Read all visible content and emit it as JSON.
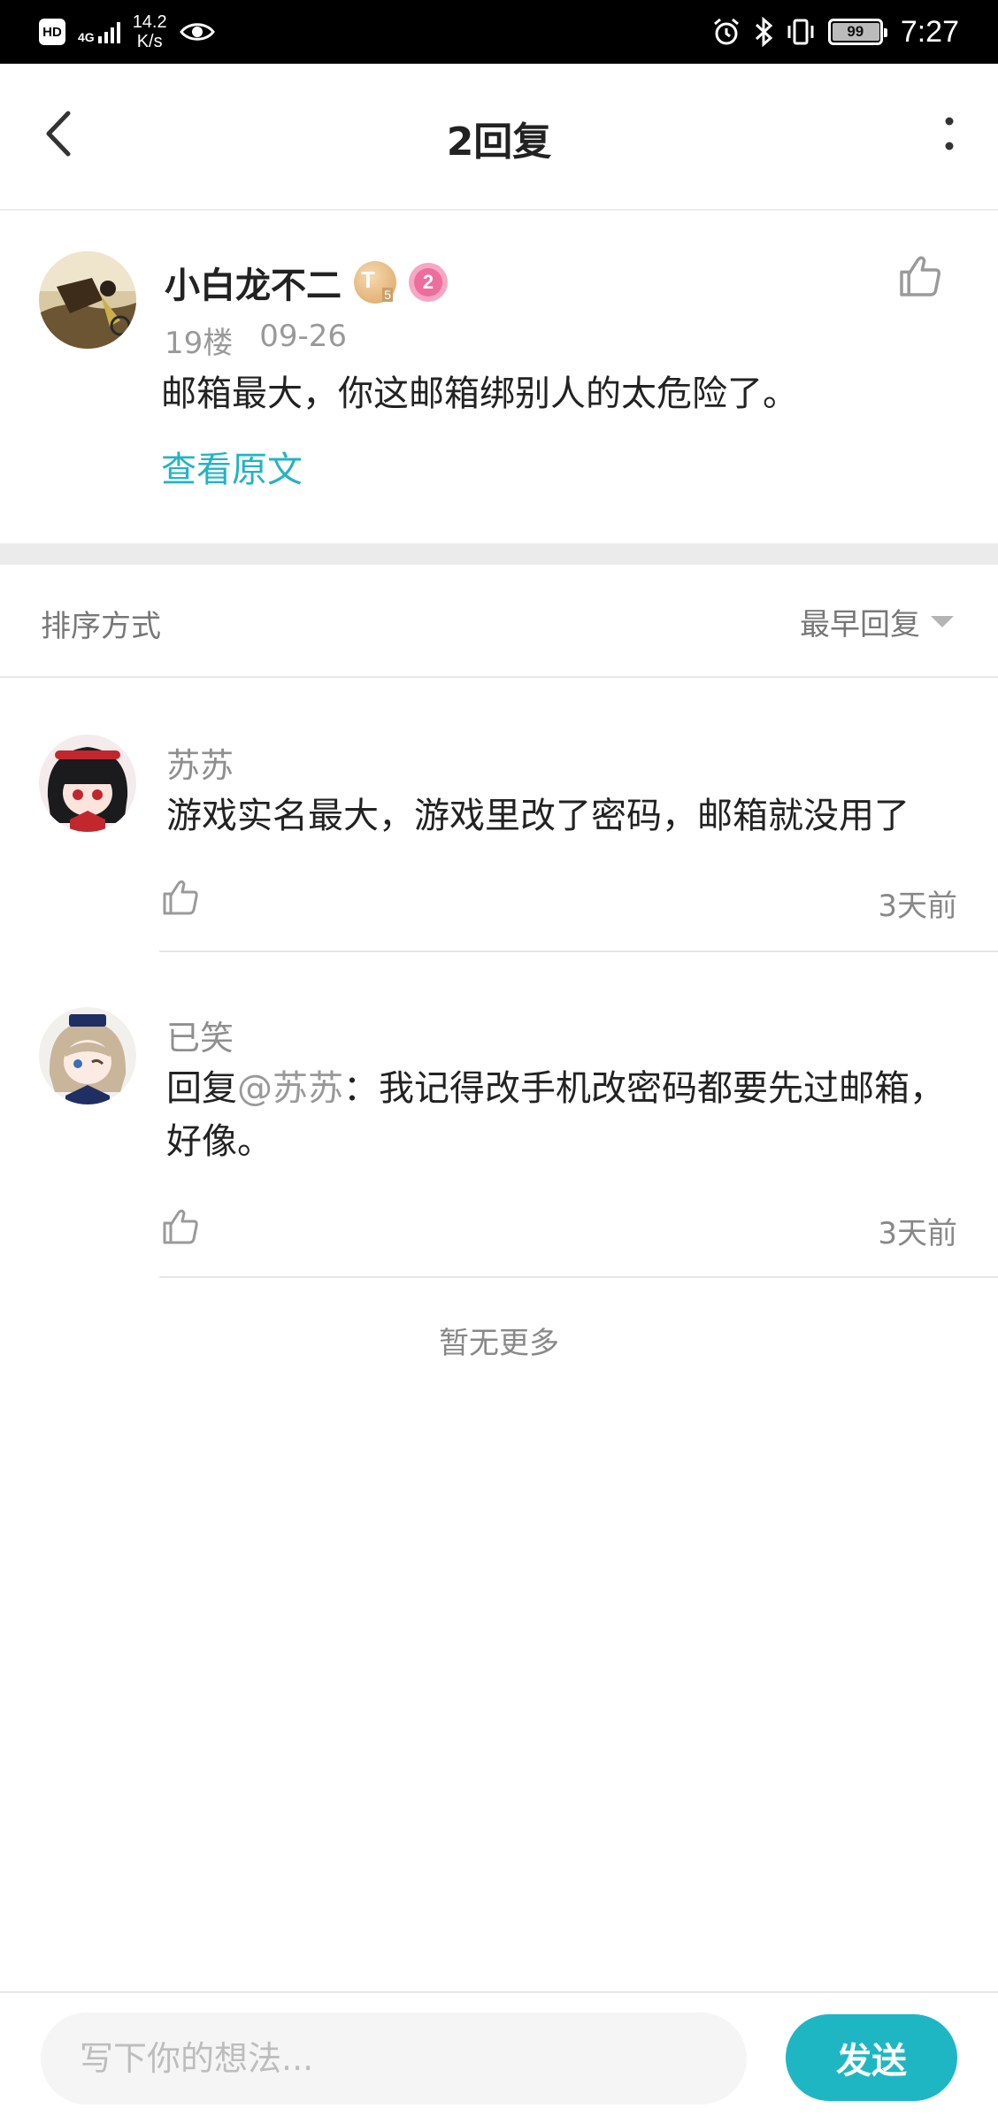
{
  "status_bar": {
    "hd": "HD",
    "network": "4G",
    "speed_value": "14.2",
    "speed_unit": "K/s",
    "battery": "99",
    "time": "7:27"
  },
  "header": {
    "title": "2回复"
  },
  "original_post": {
    "author": "小白龙不二",
    "badge_level": "2",
    "badge_t": "T",
    "badge_t_sub": "5",
    "floor": "19楼",
    "date": "09-26",
    "text": "邮箱最大，你这邮箱绑别人的太危险了。",
    "view_original": "查看原文"
  },
  "sort": {
    "label": "排序方式",
    "selected": "最早回复"
  },
  "replies": [
    {
      "name": "苏苏",
      "text": "游戏实名最大，游戏里改了密码，邮箱就没用了",
      "time": "3天前"
    },
    {
      "name": "已笑",
      "reply_prefix": "回复",
      "mention": "@苏苏",
      "text": "：我记得改手机改密码都要先过邮箱，好像。",
      "time": "3天前"
    }
  ],
  "no_more": "暂无更多",
  "composer": {
    "placeholder": "写下你的想法...",
    "send_label": "发送"
  },
  "colors": {
    "accent": "#1fb6c4",
    "link": "#23b3c3",
    "muted": "#999999"
  }
}
